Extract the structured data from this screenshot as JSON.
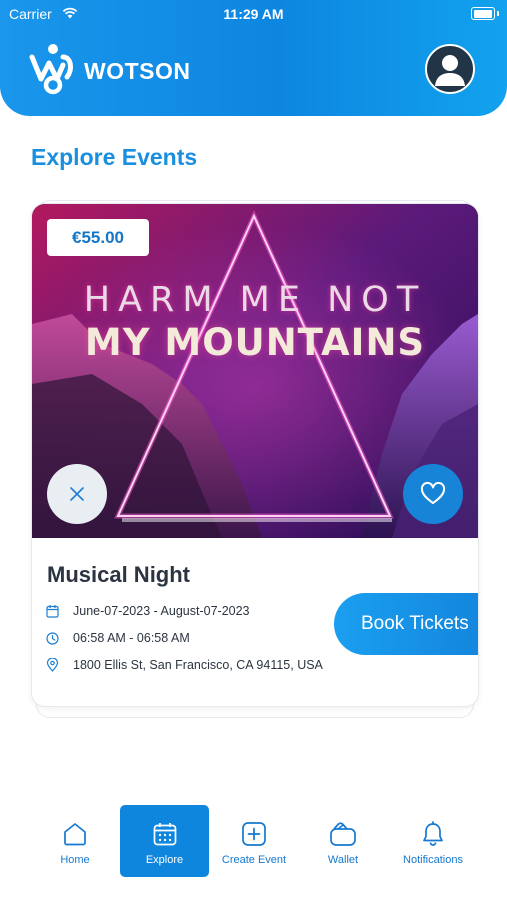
{
  "status_bar": {
    "carrier": "Carrier",
    "time": "11:29 AM"
  },
  "header": {
    "brand": "WOTSON",
    "avatar_icon": "user-avatar-icon"
  },
  "page": {
    "title": "Explore Events"
  },
  "event_card": {
    "price": "€55.00",
    "image_headline_top": "HARM ME NOT",
    "image_headline_main": "MY MOUNTAINS",
    "name": "Musical Night",
    "date_range": "June-07-2023 - August-07-2023",
    "time_range": "06:58 AM - 06:58 AM",
    "address": "1800 Ellis St, San Francisco, CA 94115, USA",
    "book_label": "Book Tickets"
  },
  "bottom_nav": {
    "items": [
      {
        "label": "Home",
        "icon": "home-icon",
        "active": false
      },
      {
        "label": "Explore",
        "icon": "calendar-icon",
        "active": true
      },
      {
        "label": "Create Event",
        "icon": "plus-square-icon",
        "active": false
      },
      {
        "label": "Wallet",
        "icon": "wallet-icon",
        "active": false
      },
      {
        "label": "Notifications",
        "icon": "bell-icon",
        "active": false
      }
    ]
  },
  "colors": {
    "accent": "#1784d8",
    "title": "#1a8fe0",
    "header": "#1a96ec"
  }
}
